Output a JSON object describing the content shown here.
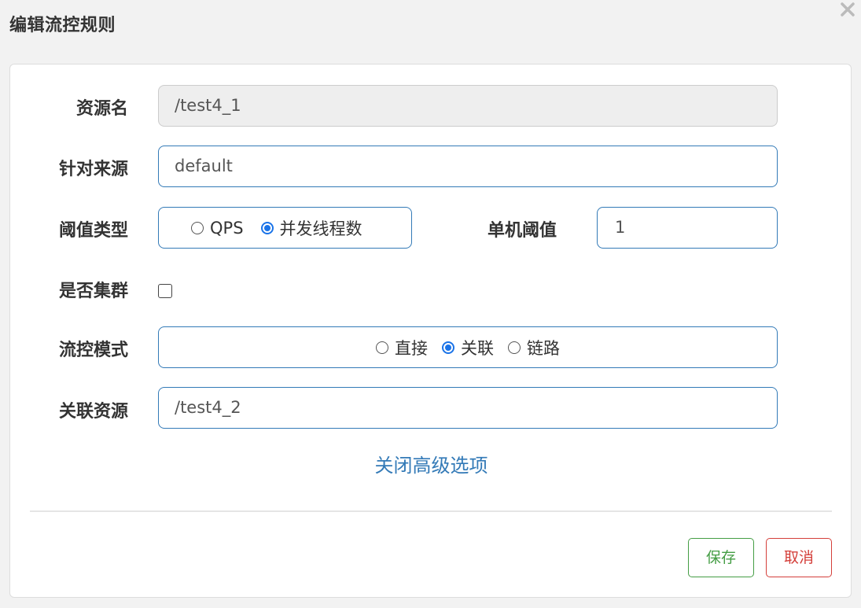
{
  "dialog": {
    "title": "编辑流控规则",
    "close_icon": "close-icon"
  },
  "form": {
    "resource_name": {
      "label": "资源名",
      "value": "/test4_1"
    },
    "limit_app": {
      "label": "针对来源",
      "value": "default"
    },
    "threshold_type": {
      "label": "阈值类型",
      "options": [
        {
          "label": "QPS",
          "checked": false
        },
        {
          "label": "并发线程数",
          "checked": true
        }
      ]
    },
    "single_threshold": {
      "label": "单机阈值",
      "value": "1"
    },
    "cluster": {
      "label": "是否集群",
      "checked": false
    },
    "control_mode": {
      "label": "流控模式",
      "options": [
        {
          "label": "直接",
          "checked": false
        },
        {
          "label": "关联",
          "checked": true
        },
        {
          "label": "链路",
          "checked": false
        }
      ]
    },
    "ref_resource": {
      "label": "关联资源",
      "value": "/test4_2"
    },
    "advanced_toggle": "关闭高级选项"
  },
  "footer": {
    "save_label": "保存",
    "cancel_label": "取消"
  },
  "colors": {
    "accent": "#337ab7",
    "radio_checked": "#1a73e8",
    "save": "#449d44",
    "cancel": "#d43f3a"
  }
}
